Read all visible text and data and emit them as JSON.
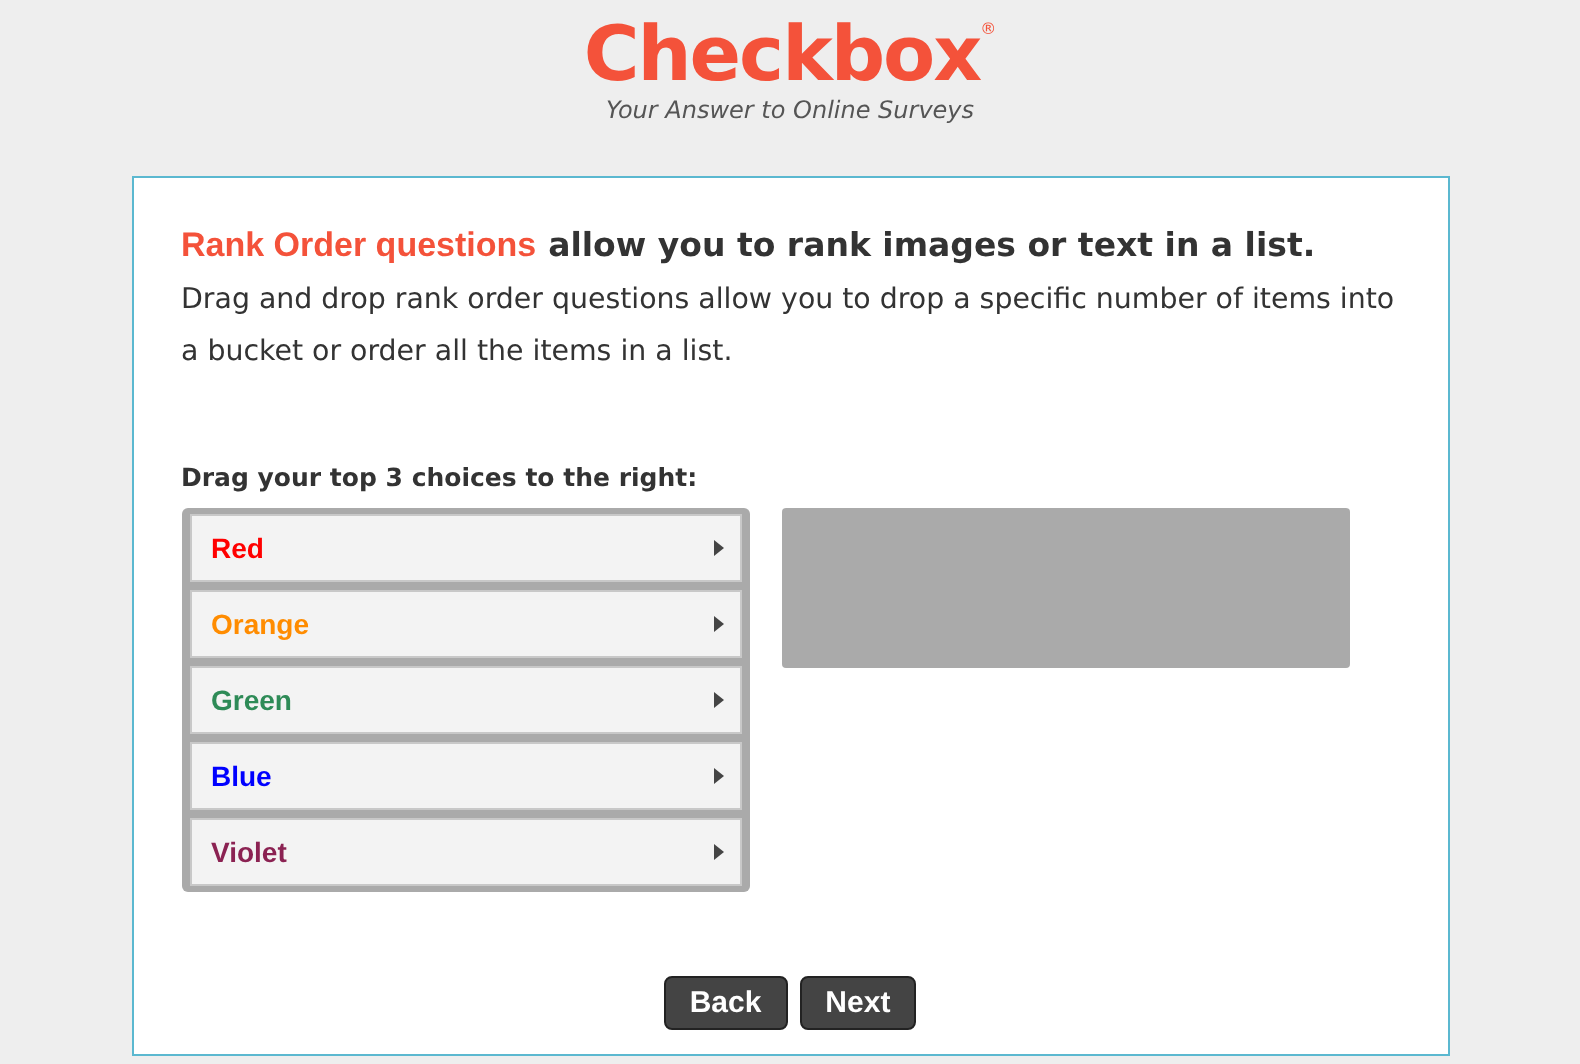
{
  "logo": {
    "name": "Checkbox",
    "registered_mark": "®",
    "tagline": "Your Answer to Online Surveys"
  },
  "question": {
    "title_highlight": "Rank Order questions",
    "title_rest": "allow you to rank images or text in a list.",
    "description": "Drag and drop rank order questions allow you to drop a specific number of items into a bucket or order all the items in a list.",
    "instruction": "Drag your top 3 choices to the right:"
  },
  "choices": [
    {
      "label": "Red",
      "color": "#ff0000"
    },
    {
      "label": "Orange",
      "color": "#ff8c00"
    },
    {
      "label": "Green",
      "color": "#2e8b57"
    },
    {
      "label": "Blue",
      "color": "#0000ff"
    },
    {
      "label": "Violet",
      "color": "#8b2252"
    }
  ],
  "buttons": [
    "Back",
    "Next"
  ]
}
